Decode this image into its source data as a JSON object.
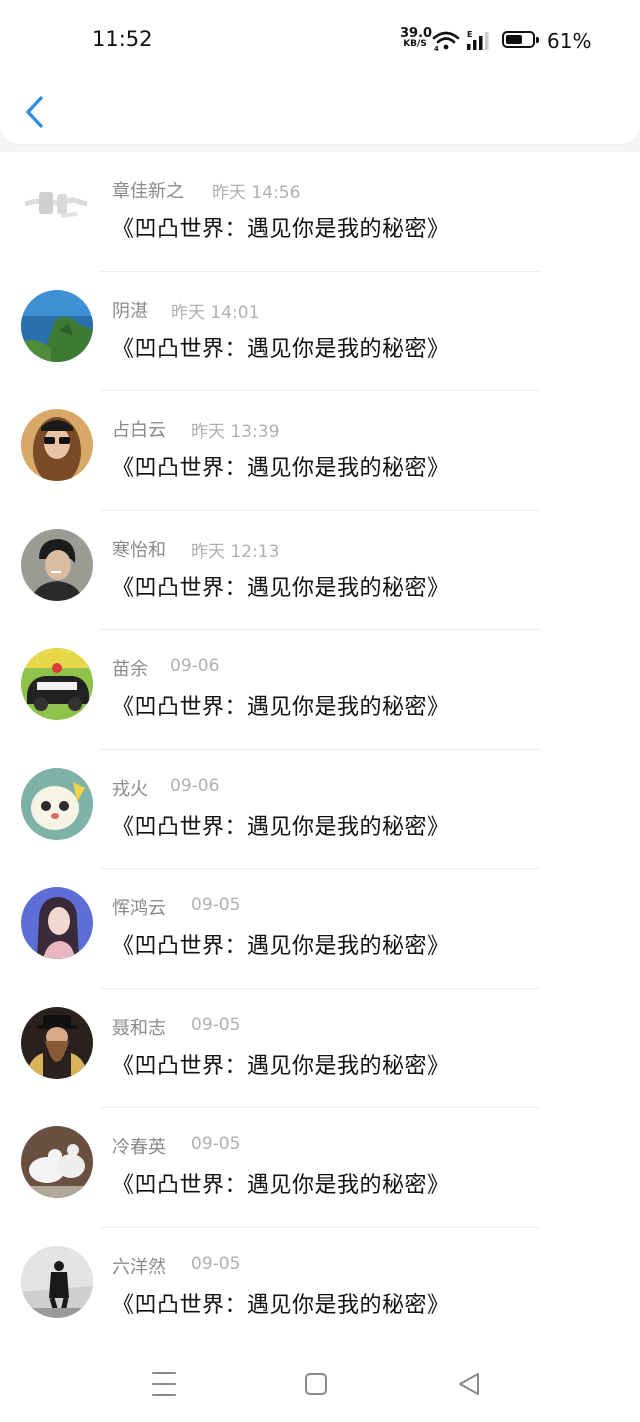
{
  "status_bar": {
    "time": "11:52",
    "net_speed_value": "39.0",
    "net_speed_unit": "KB/S",
    "battery_percent": "61%",
    "battery_level": 0.61,
    "icons": [
      "wifi-icon",
      "signal-icon",
      "battery-icon"
    ]
  },
  "header": {
    "back_icon": "chevron-left-icon",
    "accent_color": "#2f8ddf"
  },
  "list": {
    "items": [
      {
        "name": "章佳新之",
        "time": "昨天 14:56",
        "message": "《凹凸世界：遇见你是我的秘密》",
        "avatar": "avatar-sketch"
      },
      {
        "name": "阴湛",
        "time": "昨天 14:01",
        "message": "《凹凸世界：遇见你是我的秘密》",
        "avatar": "avatar-coastline"
      },
      {
        "name": "占白云",
        "time": "昨天 13:39",
        "message": "《凹凸世界：遇见你是我的秘密》",
        "avatar": "avatar-woman-sunglasses"
      },
      {
        "name": "寒怡和",
        "time": "昨天 12:13",
        "message": "《凹凸世界：遇见你是我的秘密》",
        "avatar": "avatar-man-portrait"
      },
      {
        "name": "苗余",
        "time": "09-06",
        "message": "《凹凸世界：遇见你是我的秘密》",
        "avatar": "avatar-cartoon-car"
      },
      {
        "name": "戎火",
        "time": "09-06",
        "message": "《凹凸世界：遇见你是我的秘密》",
        "avatar": "avatar-cartoon-cat"
      },
      {
        "name": "恽鸿云",
        "time": "09-05",
        "message": "《凹凸世界：遇见你是我的秘密》",
        "avatar": "avatar-anime-girl"
      },
      {
        "name": "聂和志",
        "time": "09-05",
        "message": "《凹凸世界：遇见你是我的秘密》",
        "avatar": "avatar-bearded-man"
      },
      {
        "name": "冷春英",
        "time": "09-05",
        "message": "《凹凸世界：遇见你是我的秘密》",
        "avatar": "avatar-doves"
      },
      {
        "name": "六洋然",
        "time": "09-05",
        "message": "《凹凸世界：遇见你是我的秘密》",
        "avatar": "avatar-person-street"
      }
    ]
  },
  "nav": {
    "buttons": [
      "menu-icon",
      "home-square-icon",
      "back-triangle-icon"
    ]
  }
}
